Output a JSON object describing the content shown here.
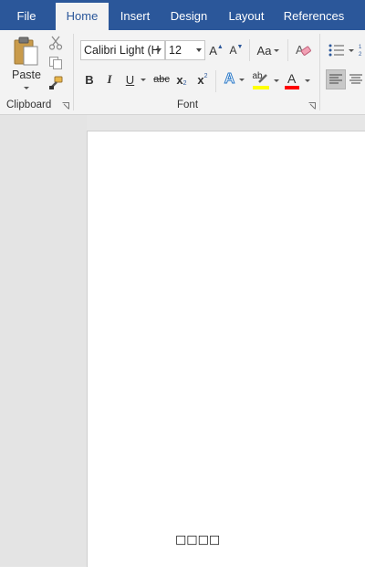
{
  "tabs": [
    "File",
    "Home",
    "Insert",
    "Design",
    "Layout",
    "References"
  ],
  "active_tab": "Home",
  "clipboard": {
    "group_label": "Clipboard",
    "paste_label": "Paste",
    "cut_icon": "scissors-icon",
    "copy_icon": "copy-icon",
    "format_painter_icon": "paintbrush-icon"
  },
  "font": {
    "group_label": "Font",
    "font_name": "Calibri Light (H",
    "font_size": "12",
    "grow_label": "A",
    "shrink_label": "A",
    "case_label": "Aa",
    "bold": "B",
    "italic": "I",
    "underline": "U",
    "strike": "abc",
    "subscript": "x",
    "subscript_mark": "2",
    "superscript": "x",
    "superscript_mark": "2",
    "text_effects": "A",
    "highlight": "ab",
    "font_color": "A",
    "highlight_color": "#ffff00",
    "font_color_value": "#ff0000"
  },
  "document": {
    "text": "□□□□"
  }
}
